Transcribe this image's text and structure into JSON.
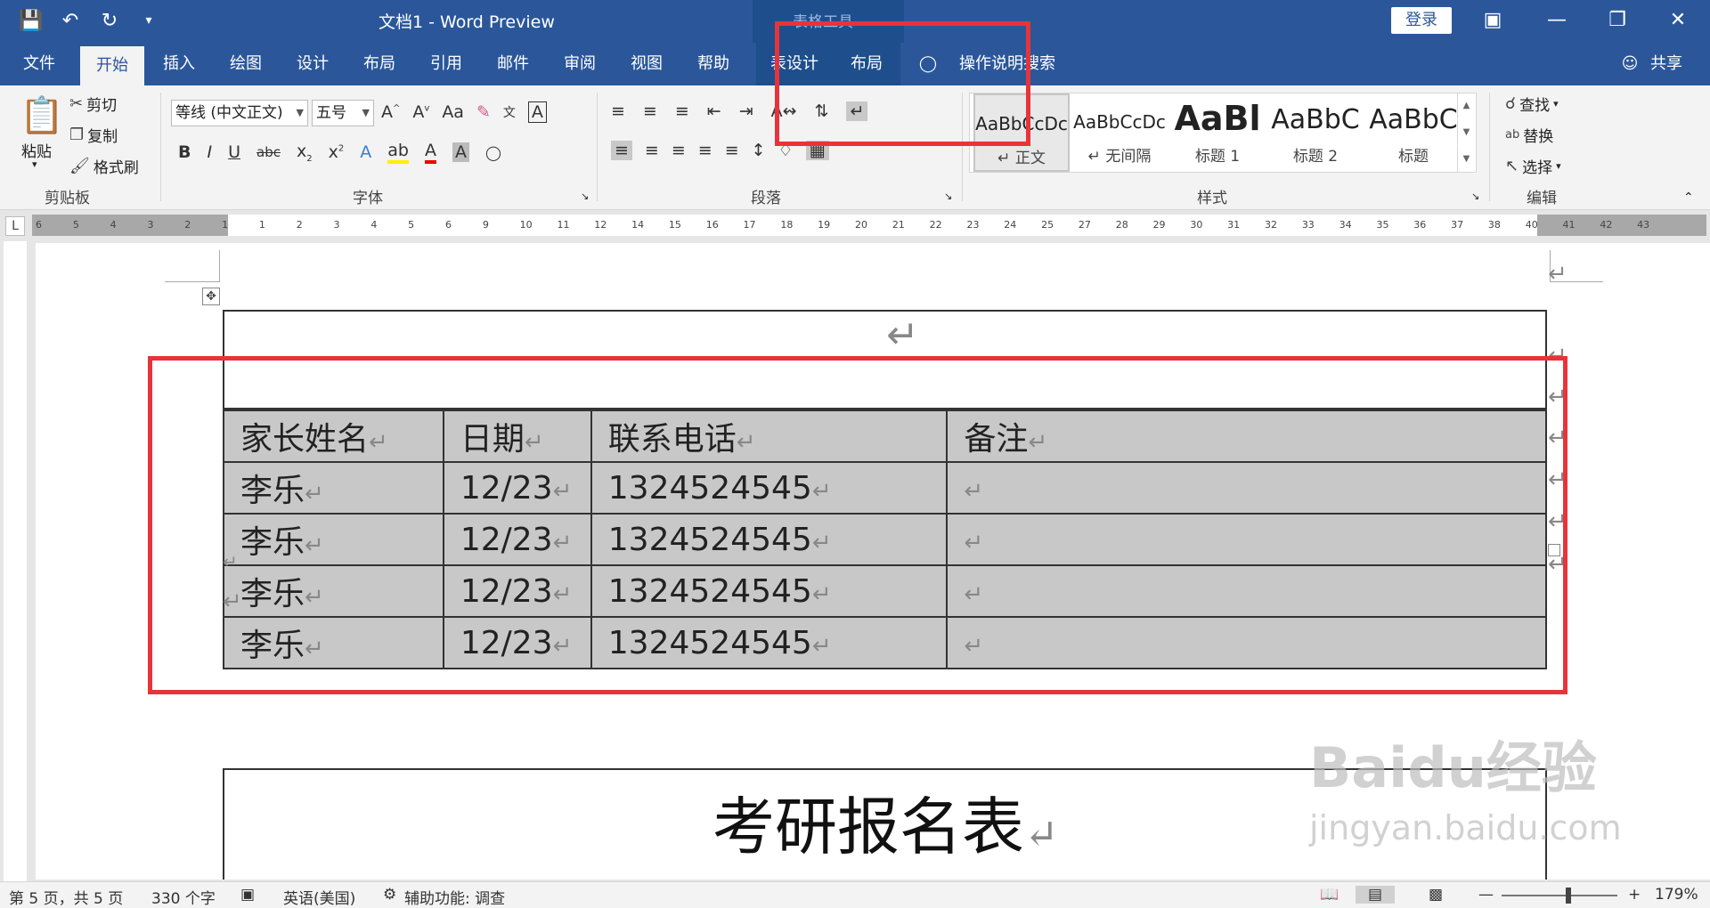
{
  "window": {
    "title": "文档1  -  Word Preview",
    "context_tab_title": "表格工具",
    "login": "登录"
  },
  "tabs": [
    "文件",
    "开始",
    "插入",
    "绘图",
    "设计",
    "布局",
    "引用",
    "邮件",
    "审阅",
    "视图",
    "帮助",
    "表设计",
    "布局"
  ],
  "tell_me": "操作说明搜索",
  "share": "共享",
  "clipboard": {
    "paste": "粘贴",
    "cut": "剪切",
    "copy": "复制",
    "format_painter": "格式刷",
    "label": "剪贴板"
  },
  "font": {
    "name": "等线 (中文正文)",
    "size": "五号",
    "label": "字体",
    "case": "Aa"
  },
  "paragraph": {
    "label": "段落"
  },
  "styles": {
    "label": "样式",
    "items": [
      {
        "preview": "AaBbCcDc",
        "name": "↵ 正文"
      },
      {
        "preview": "AaBbCcDc",
        "name": "↵ 无间隔"
      },
      {
        "preview": "AaBl",
        "name": "标题 1"
      },
      {
        "preview": "AaBbC",
        "name": "标题 2"
      },
      {
        "preview": "AaBbC",
        "name": "标题"
      }
    ]
  },
  "editing": {
    "find": "查找",
    "replace": "替换",
    "select": "选择",
    "label": "编辑"
  },
  "ruler_numbers": [
    "6",
    "5",
    "4",
    "3",
    "2",
    "1",
    "1",
    "2",
    "3",
    "4",
    "5",
    "6",
    "9",
    "10",
    "11",
    "12",
    "14",
    "15",
    "16",
    "17",
    "18",
    "19",
    "20",
    "21",
    "22",
    "23",
    "24",
    "25",
    "27",
    "28",
    "29",
    "30",
    "31",
    "32",
    "33",
    "34",
    "35",
    "36",
    "37",
    "38",
    "40",
    "41",
    "42",
    "43"
  ],
  "table": {
    "headers": [
      "家长姓名",
      "日期",
      "联系电话",
      "备注"
    ],
    "rows": [
      [
        "李乐",
        "12/23",
        "1324524545",
        ""
      ],
      [
        "李乐",
        "12/23",
        "1324524545",
        ""
      ],
      [
        "李乐",
        "12/23",
        "1324524545",
        ""
      ],
      [
        "李乐",
        "12/23",
        "1324524545",
        ""
      ]
    ],
    "return_mark": "↵"
  },
  "next_table_title": "考研报名表",
  "watermark": {
    "brand": "Baidu经验",
    "url": "jingyan.baidu.com"
  },
  "status": {
    "page": "第 5 页，共 5 页",
    "words": "330 个字",
    "language": "英语(美国)",
    "accessibility": "辅助功能: 调查",
    "zoom": "179%"
  },
  "colors": {
    "accent": "#2b579a",
    "annotation": "#e8333a",
    "cell_shading": "#c8c8c8"
  }
}
